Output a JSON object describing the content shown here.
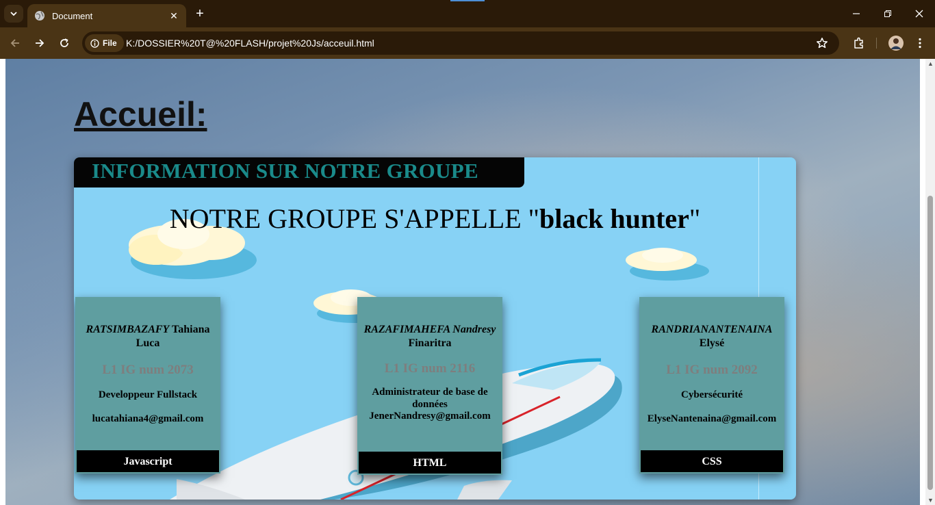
{
  "browser": {
    "tab_title": "Document",
    "file_chip": "File",
    "url": "K:/DOSSIER%20T@%20FLASH/projet%20Js/acceuil.html"
  },
  "page": {
    "heading": "Accueil:",
    "banner": "INFORMATION SUR NOTRE GROUPE",
    "group_prefix": "NOTRE GROUPE S'APPELLE \"",
    "group_name": "black hunter",
    "group_suffix": "\"",
    "cards": [
      {
        "last": "RATSIMBAZAFY",
        "first": "Tahiana Luca",
        "num": "L1 IG num 2073",
        "role": "Developpeur Fullstack",
        "email": "lucatahiana4@gmail.com",
        "lang": "Javascript"
      },
      {
        "last": "RAZAFIMAHEFA Nandresy",
        "first": "Finaritra",
        "num": "L1 IG num 2116",
        "role": "Administrateur de base de données",
        "email": "JenerNandresy@gmail.com",
        "lang": "HTML"
      },
      {
        "last": "RANDRIANANTENAINA",
        "first": "Elysé",
        "num": "L1 IG num 2092",
        "role": "Cybersécurité",
        "email": "ElyseNantenaina@gmail.com",
        "lang": "CSS"
      }
    ]
  },
  "colors": {
    "panel": "#87d2f5",
    "card": "#5f9ea0",
    "banner_text": "#1a8a8a"
  },
  "icons": [
    "tab-search-icon",
    "globe-icon",
    "close-icon",
    "plus-icon",
    "minimize-icon",
    "restore-icon",
    "back-icon",
    "forward-icon",
    "reload-icon",
    "info-icon",
    "star-icon",
    "extensions-icon",
    "profile-avatar",
    "menu-icon"
  ]
}
